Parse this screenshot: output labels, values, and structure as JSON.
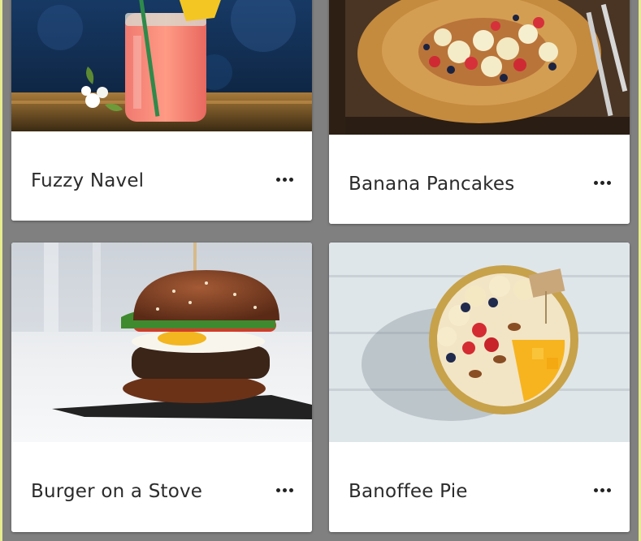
{
  "cards": [
    {
      "title": "Fuzzy Navel",
      "image_subject": "pink drink in mason jar with straw and flowers",
      "menu_icon": "more-horizontal-icon"
    },
    {
      "title": "Banana Pancakes",
      "image_subject": "pancakes with banana and strawberries on a wooden tray",
      "menu_icon": "more-horizontal-icon"
    },
    {
      "title": "Burger on a Stove",
      "image_subject": "burger with egg and greens on slate",
      "menu_icon": "more-horizontal-icon"
    },
    {
      "title": "Banoffee Pie",
      "image_subject": "fruit bowl with banana, berries and mango on white wood",
      "menu_icon": "more-horizontal-icon"
    }
  ],
  "colors": {
    "background": "#808080",
    "card": "#ffffff",
    "title_text": "#2b2b2b",
    "edge_highlight": "#e6ec8f"
  }
}
